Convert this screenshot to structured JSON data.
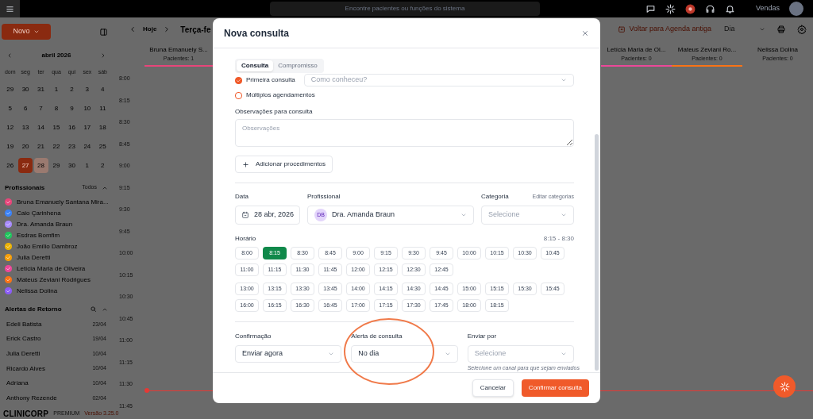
{
  "top_bar": {
    "search_placeholder": "Encontre pacientes ou funções do sistema",
    "user_label": "Vendas"
  },
  "sidebar": {
    "new_button": "Novo",
    "calendar": {
      "month": "abril 2026",
      "weekdays": [
        "dom",
        "seg",
        "ter",
        "qua",
        "qui",
        "sex",
        "sáb"
      ],
      "days": [
        {
          "label": "29",
          "selected": false,
          "today": false
        },
        {
          "label": "30",
          "selected": false,
          "today": false
        },
        {
          "label": "31",
          "selected": false,
          "today": false
        },
        {
          "label": "1",
          "selected": false,
          "today": false
        },
        {
          "label": "2",
          "selected": false,
          "today": false
        },
        {
          "label": "3",
          "selected": false,
          "today": false
        },
        {
          "label": "4",
          "selected": false,
          "today": false
        },
        {
          "label": "5",
          "selected": false,
          "today": false
        },
        {
          "label": "6",
          "selected": false,
          "today": false
        },
        {
          "label": "7",
          "selected": false,
          "today": false
        },
        {
          "label": "8",
          "selected": false,
          "today": false
        },
        {
          "label": "9",
          "selected": false,
          "today": false
        },
        {
          "label": "10",
          "selected": false,
          "today": false
        },
        {
          "label": "11",
          "selected": false,
          "today": false
        },
        {
          "label": "12",
          "selected": false,
          "today": false
        },
        {
          "label": "13",
          "selected": false,
          "today": false
        },
        {
          "label": "14",
          "selected": false,
          "today": false
        },
        {
          "label": "15",
          "selected": false,
          "today": false
        },
        {
          "label": "16",
          "selected": false,
          "today": false
        },
        {
          "label": "17",
          "selected": false,
          "today": false
        },
        {
          "label": "18",
          "selected": false,
          "today": false
        },
        {
          "label": "19",
          "selected": false,
          "today": false
        },
        {
          "label": "20",
          "selected": false,
          "today": false
        },
        {
          "label": "21",
          "selected": false,
          "today": false
        },
        {
          "label": "22",
          "selected": false,
          "today": false
        },
        {
          "label": "23",
          "selected": false,
          "today": false
        },
        {
          "label": "24",
          "selected": false,
          "today": false
        },
        {
          "label": "25",
          "selected": false,
          "today": false
        },
        {
          "label": "26",
          "selected": false,
          "today": false
        },
        {
          "label": "27",
          "selected": true,
          "today": false
        },
        {
          "label": "28",
          "selected": false,
          "today": true
        },
        {
          "label": "29",
          "selected": false,
          "today": false
        },
        {
          "label": "30",
          "selected": false,
          "today": false
        },
        {
          "label": "1",
          "selected": false,
          "today": false
        },
        {
          "label": "2",
          "selected": false,
          "today": false
        }
      ]
    },
    "professionals_title": "Profissionais",
    "professionals_filter": "Todos",
    "professionals": [
      {
        "name": "Bruna Emanuely Santana Mira...",
        "color": "#e8457a",
        "checked": true
      },
      {
        "name": "Caio Çarinhena",
        "color": "#3b82f6",
        "checked": true
      },
      {
        "name": "Dra. Amanda Braun",
        "color": "#a78bfa",
        "checked": true
      },
      {
        "name": "Esdras Bomfim",
        "color": "#22c55e",
        "checked": true
      },
      {
        "name": "João Emílio Dambroz",
        "color": "#eab308",
        "checked": true
      },
      {
        "name": "Julia Deretti",
        "color": "#f59e0b",
        "checked": true
      },
      {
        "name": "Letícia Maria de Oliveira",
        "color": "#ec4899",
        "checked": true
      },
      {
        "name": "Mateus Zeviani Rodrigues",
        "color": "#f97316",
        "checked": true
      },
      {
        "name": "Nelissa Dolina",
        "color": "#8b5cf6",
        "checked": true
      }
    ],
    "alerts_title": "Alertas de Retorno",
    "alerts": [
      {
        "name": "Edeli Batista",
        "date": "23/04"
      },
      {
        "name": "Erick Castro",
        "date": "19/04"
      },
      {
        "name": "Julia Deretti",
        "date": "10/04"
      },
      {
        "name": "Ricardo Alves",
        "date": "10/04"
      },
      {
        "name": "Adriana",
        "date": "10/04"
      },
      {
        "name": "Anthony Rezende",
        "date": "02/04"
      }
    ],
    "footer": {
      "brand": "CLINICORP",
      "plan": "PREMIUM",
      "version": "Versão 3.25.0"
    }
  },
  "agenda": {
    "today_button": "Hoje",
    "date_title": "Terça-fe",
    "back_link": "Voltar para Agenda antiga",
    "view": "Dia",
    "columns": [
      {
        "name": "Bruna Emanuely S...",
        "patients": "Pacientes: 1",
        "color": "#e8457a"
      },
      {
        "name": "Letícia Maria de Ol...",
        "patients": "Pacientes: 0",
        "color": "#ec4899"
      },
      {
        "name": "Mateus Zeviani Ro...",
        "patients": "Pacientes: 0",
        "color": "#f97316"
      },
      {
        "name": "Nelissa Dolina",
        "patients": "Pacientes: 0"
      }
    ],
    "times": [
      "8:00",
      "8:15",
      "8:30",
      "8:45",
      "9:00",
      "9:15",
      "9:30",
      "9:45",
      "10:00",
      "10:15",
      "10:30",
      "10:45",
      "11:00",
      "11:15",
      "11:30",
      "11:45"
    ]
  },
  "modal": {
    "title": "Nova consulta",
    "tabs": [
      {
        "label": "Consulta",
        "selected": true
      },
      {
        "label": "Compromisso",
        "selected": false
      }
    ],
    "first_visit": {
      "label": "Primeira consulta",
      "checked": true
    },
    "source_select": {
      "placeholder": "Como conheceu?"
    },
    "multiple": {
      "label": "Múltiplos agendamentos",
      "checked": false
    },
    "notes": {
      "label": "Observações para consulta",
      "placeholder": "Observações"
    },
    "add_procedures": "Adicionar procedimentos",
    "date": {
      "label": "Data",
      "value": "28 abr, 2026"
    },
    "professional": {
      "label": "Profissional",
      "initials": "DB",
      "value": "Dra. Amanda Braun"
    },
    "category": {
      "label": "Categoria",
      "link": "Editar categorias",
      "placeholder": "Selecione"
    },
    "schedule": {
      "label": "Horário",
      "range": "8:15 - 8:30",
      "groups": [
        {
          "slots": [
            {
              "label": "8:00",
              "selected": false
            },
            {
              "label": "8:15",
              "selected": true
            },
            {
              "label": "8:30",
              "selected": false
            },
            {
              "label": "8:45",
              "selected": false
            },
            {
              "label": "9:00",
              "selected": false
            },
            {
              "label": "9:15",
              "selected": false
            },
            {
              "label": "9:30",
              "selected": false
            },
            {
              "label": "9:45",
              "selected": false
            },
            {
              "label": "10:00",
              "selected": false
            },
            {
              "label": "10:15",
              "selected": false
            },
            {
              "label": "10:30",
              "selected": false
            },
            {
              "label": "10:45",
              "selected": false
            },
            {
              "label": "11:00",
              "selected": false
            },
            {
              "label": "11:15",
              "selected": false
            },
            {
              "label": "11:30",
              "selected": false
            },
            {
              "label": "11:45",
              "selected": false
            },
            {
              "label": "12:00",
              "selected": false
            },
            {
              "label": "12:15",
              "selected": false
            },
            {
              "label": "12:30",
              "selected": false
            },
            {
              "label": "12:45",
              "selected": false
            }
          ]
        },
        {
          "slots": [
            {
              "label": "13:00",
              "selected": false
            },
            {
              "label": "13:15",
              "selected": false
            },
            {
              "label": "13:30",
              "selected": false
            },
            {
              "label": "13:45",
              "selected": false
            },
            {
              "label": "14:00",
              "selected": false
            },
            {
              "label": "14:15",
              "selected": false
            },
            {
              "label": "14:30",
              "selected": false
            },
            {
              "label": "14:45",
              "selected": false
            },
            {
              "label": "15:00",
              "selected": false
            },
            {
              "label": "15:15",
              "selected": false
            },
            {
              "label": "15:30",
              "selected": false
            },
            {
              "label": "15:45",
              "selected": false
            },
            {
              "label": "16:00",
              "selected": false
            },
            {
              "label": "16:15",
              "selected": false
            },
            {
              "label": "16:30",
              "selected": false
            },
            {
              "label": "16:45",
              "selected": false
            },
            {
              "label": "17:00",
              "selected": false
            },
            {
              "label": "17:15",
              "selected": false
            },
            {
              "label": "17:30",
              "selected": false
            },
            {
              "label": "17:45",
              "selected": false
            },
            {
              "label": "18:00",
              "selected": false
            },
            {
              "label": "18:15",
              "selected": false
            }
          ]
        }
      ]
    },
    "confirmation": {
      "label": "Confirmação",
      "value": "Enviar agora"
    },
    "alert": {
      "label": "Alerta de consulta",
      "value": "No dia"
    },
    "send_via": {
      "label": "Enviar por",
      "placeholder": "Selecione",
      "hint": "Selecione um canal para que sejam enviados"
    },
    "buttons": [
      {
        "label": "Cancelar",
        "kind": "secondary"
      },
      {
        "label": "Confirmar consulta",
        "kind": "primary"
      }
    ]
  }
}
